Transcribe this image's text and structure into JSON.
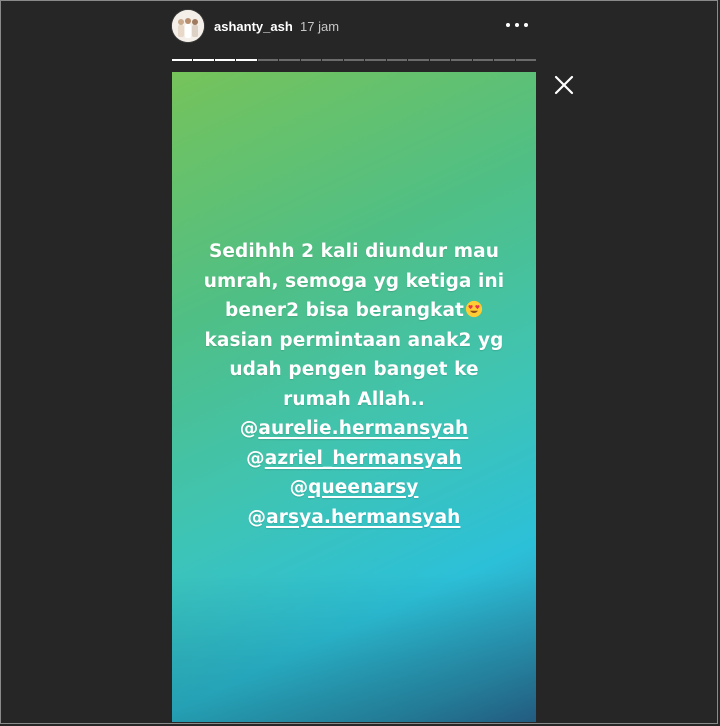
{
  "user": {
    "username": "ashanty_ash",
    "time": "17 jam"
  },
  "icons": {
    "avatar": "avatar-photo",
    "more": "more-dots-icon",
    "close": "close-icon",
    "emoji": "heart-eyes-emoji"
  },
  "progress": {
    "segments_total": 17,
    "segments_done": 4
  },
  "story": {
    "caption_lines": [
      "Sedihhh 2 kali diundur mau",
      "umrah, semoga yg ketiga ini",
      "bener2 bisa berangkat",
      "kasian permintaan anak2 yg",
      "udah pengen banget ke",
      "rumah Allah.."
    ],
    "mentions": [
      "aurelie.hermansyah",
      "azriel_hermansyah",
      "queenarsy",
      "arsya.hermansyah"
    ],
    "mention_prefix": "@",
    "colors": {
      "gradient_top": "#76c35a",
      "gradient_mid": "#3ec4b6",
      "gradient_bottom": "#2a6f9b"
    }
  },
  "colors": {
    "background": "#262626",
    "text": "#ffffff",
    "muted_text": "#c7c7c7"
  }
}
